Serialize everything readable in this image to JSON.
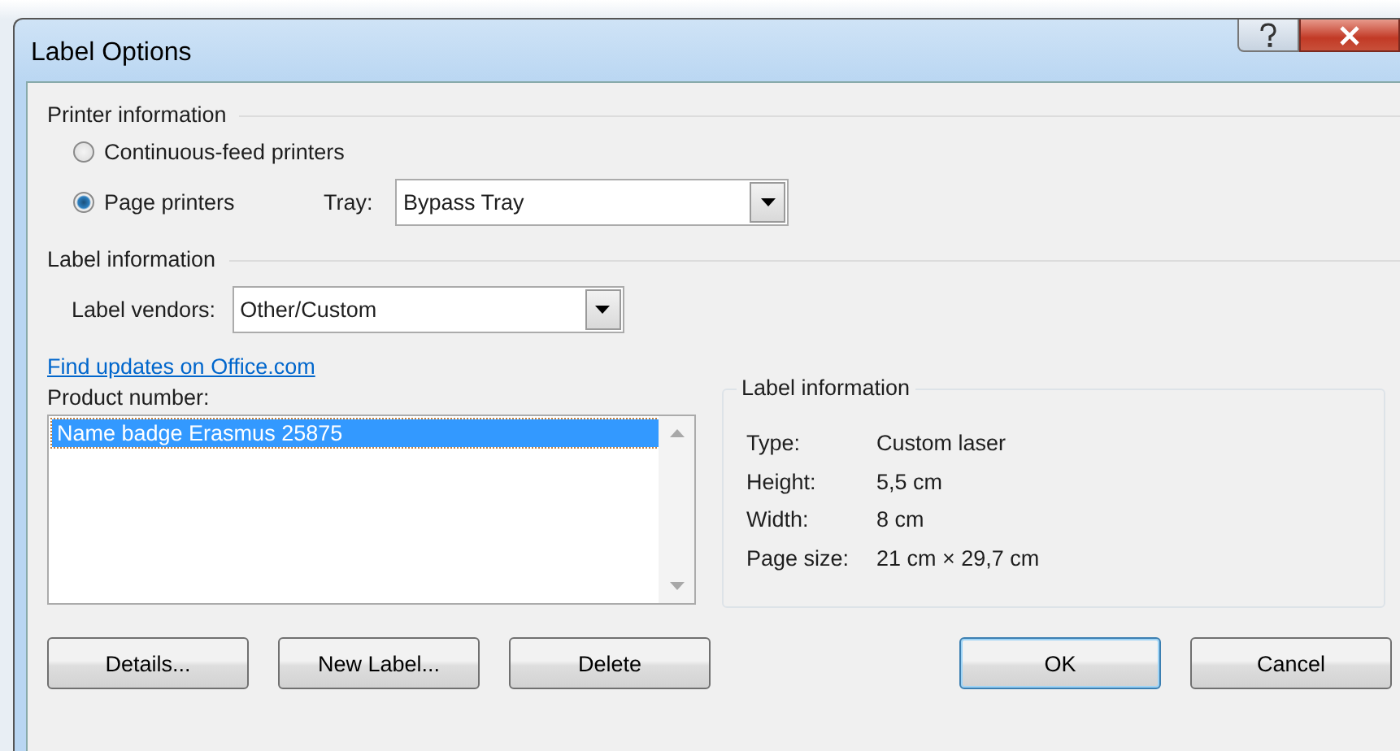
{
  "window": {
    "title": "Label Options"
  },
  "printer_information": {
    "heading": "Printer information",
    "options": [
      {
        "label": "Continuous-feed printers",
        "selected": false
      },
      {
        "label": "Page printers",
        "selected": true
      }
    ],
    "tray": {
      "label": "Tray:",
      "value": "Bypass Tray"
    }
  },
  "label_information": {
    "heading": "Label information",
    "vendors": {
      "label": "Label vendors:",
      "value": "Other/Custom"
    }
  },
  "link": "Find updates on Office.com",
  "product_number": {
    "label": "Product number:",
    "items": [
      {
        "text": "Name badge Erasmus 25875",
        "selected": true
      }
    ]
  },
  "details": {
    "heading": "Label information",
    "rows": [
      {
        "name": "Type:",
        "value": "Custom laser"
      },
      {
        "name": "Height:",
        "value": "5,5 cm"
      },
      {
        "name": "Width:",
        "value": "8 cm"
      },
      {
        "name": "Page size:",
        "value": "21 cm × 29,7 cm"
      }
    ]
  },
  "buttons": [
    {
      "label": "Details...",
      "default": false
    },
    {
      "label": "New Label...",
      "default": false
    },
    {
      "label": "Delete",
      "default": false
    },
    {
      "label": "OK",
      "default": true
    },
    {
      "label": "Cancel",
      "default": false
    }
  ]
}
